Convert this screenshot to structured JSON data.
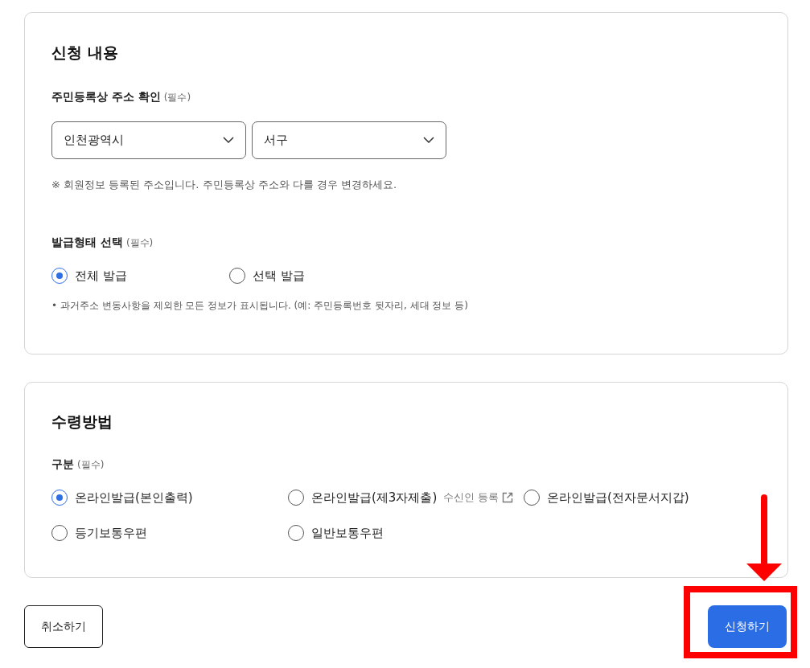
{
  "application": {
    "title": "신청 내용",
    "address": {
      "label": "주민등록상 주소 확인",
      "required": "(필수)",
      "selects": [
        {
          "value": "인천광역시"
        },
        {
          "value": "서구"
        }
      ],
      "note": "※ 회원정보 등록된 주소입니다. 주민등록상 주소와 다를 경우 변경하세요."
    },
    "issue_type": {
      "label": "발급형태 선택",
      "required": "(필수)",
      "options": [
        {
          "label": "전체 발급",
          "selected": true
        },
        {
          "label": "선택 발급",
          "selected": false
        }
      ],
      "note": "• 과거주소 변동사항을 제외한 모든 정보가 표시됩니다. (예: 주민등록번호 뒷자리, 세대 정보 등)"
    }
  },
  "receipt": {
    "title": "수령방법",
    "label": "구분",
    "required": "(필수)",
    "options": [
      {
        "label": "온라인발급(본인출력)",
        "selected": true
      },
      {
        "label": "온라인발급(제3자제출)",
        "selected": false,
        "link": "수신인 등록"
      },
      {
        "label": "온라인발급(전자문서지갑)",
        "selected": false
      },
      {
        "label": "등기보통우편",
        "selected": false
      },
      {
        "label": "일반보통우편",
        "selected": false
      }
    ]
  },
  "buttons": [
    {
      "label": "취소하기",
      "kind": "secondary"
    },
    {
      "label": "신청하기",
      "kind": "primary"
    }
  ]
}
